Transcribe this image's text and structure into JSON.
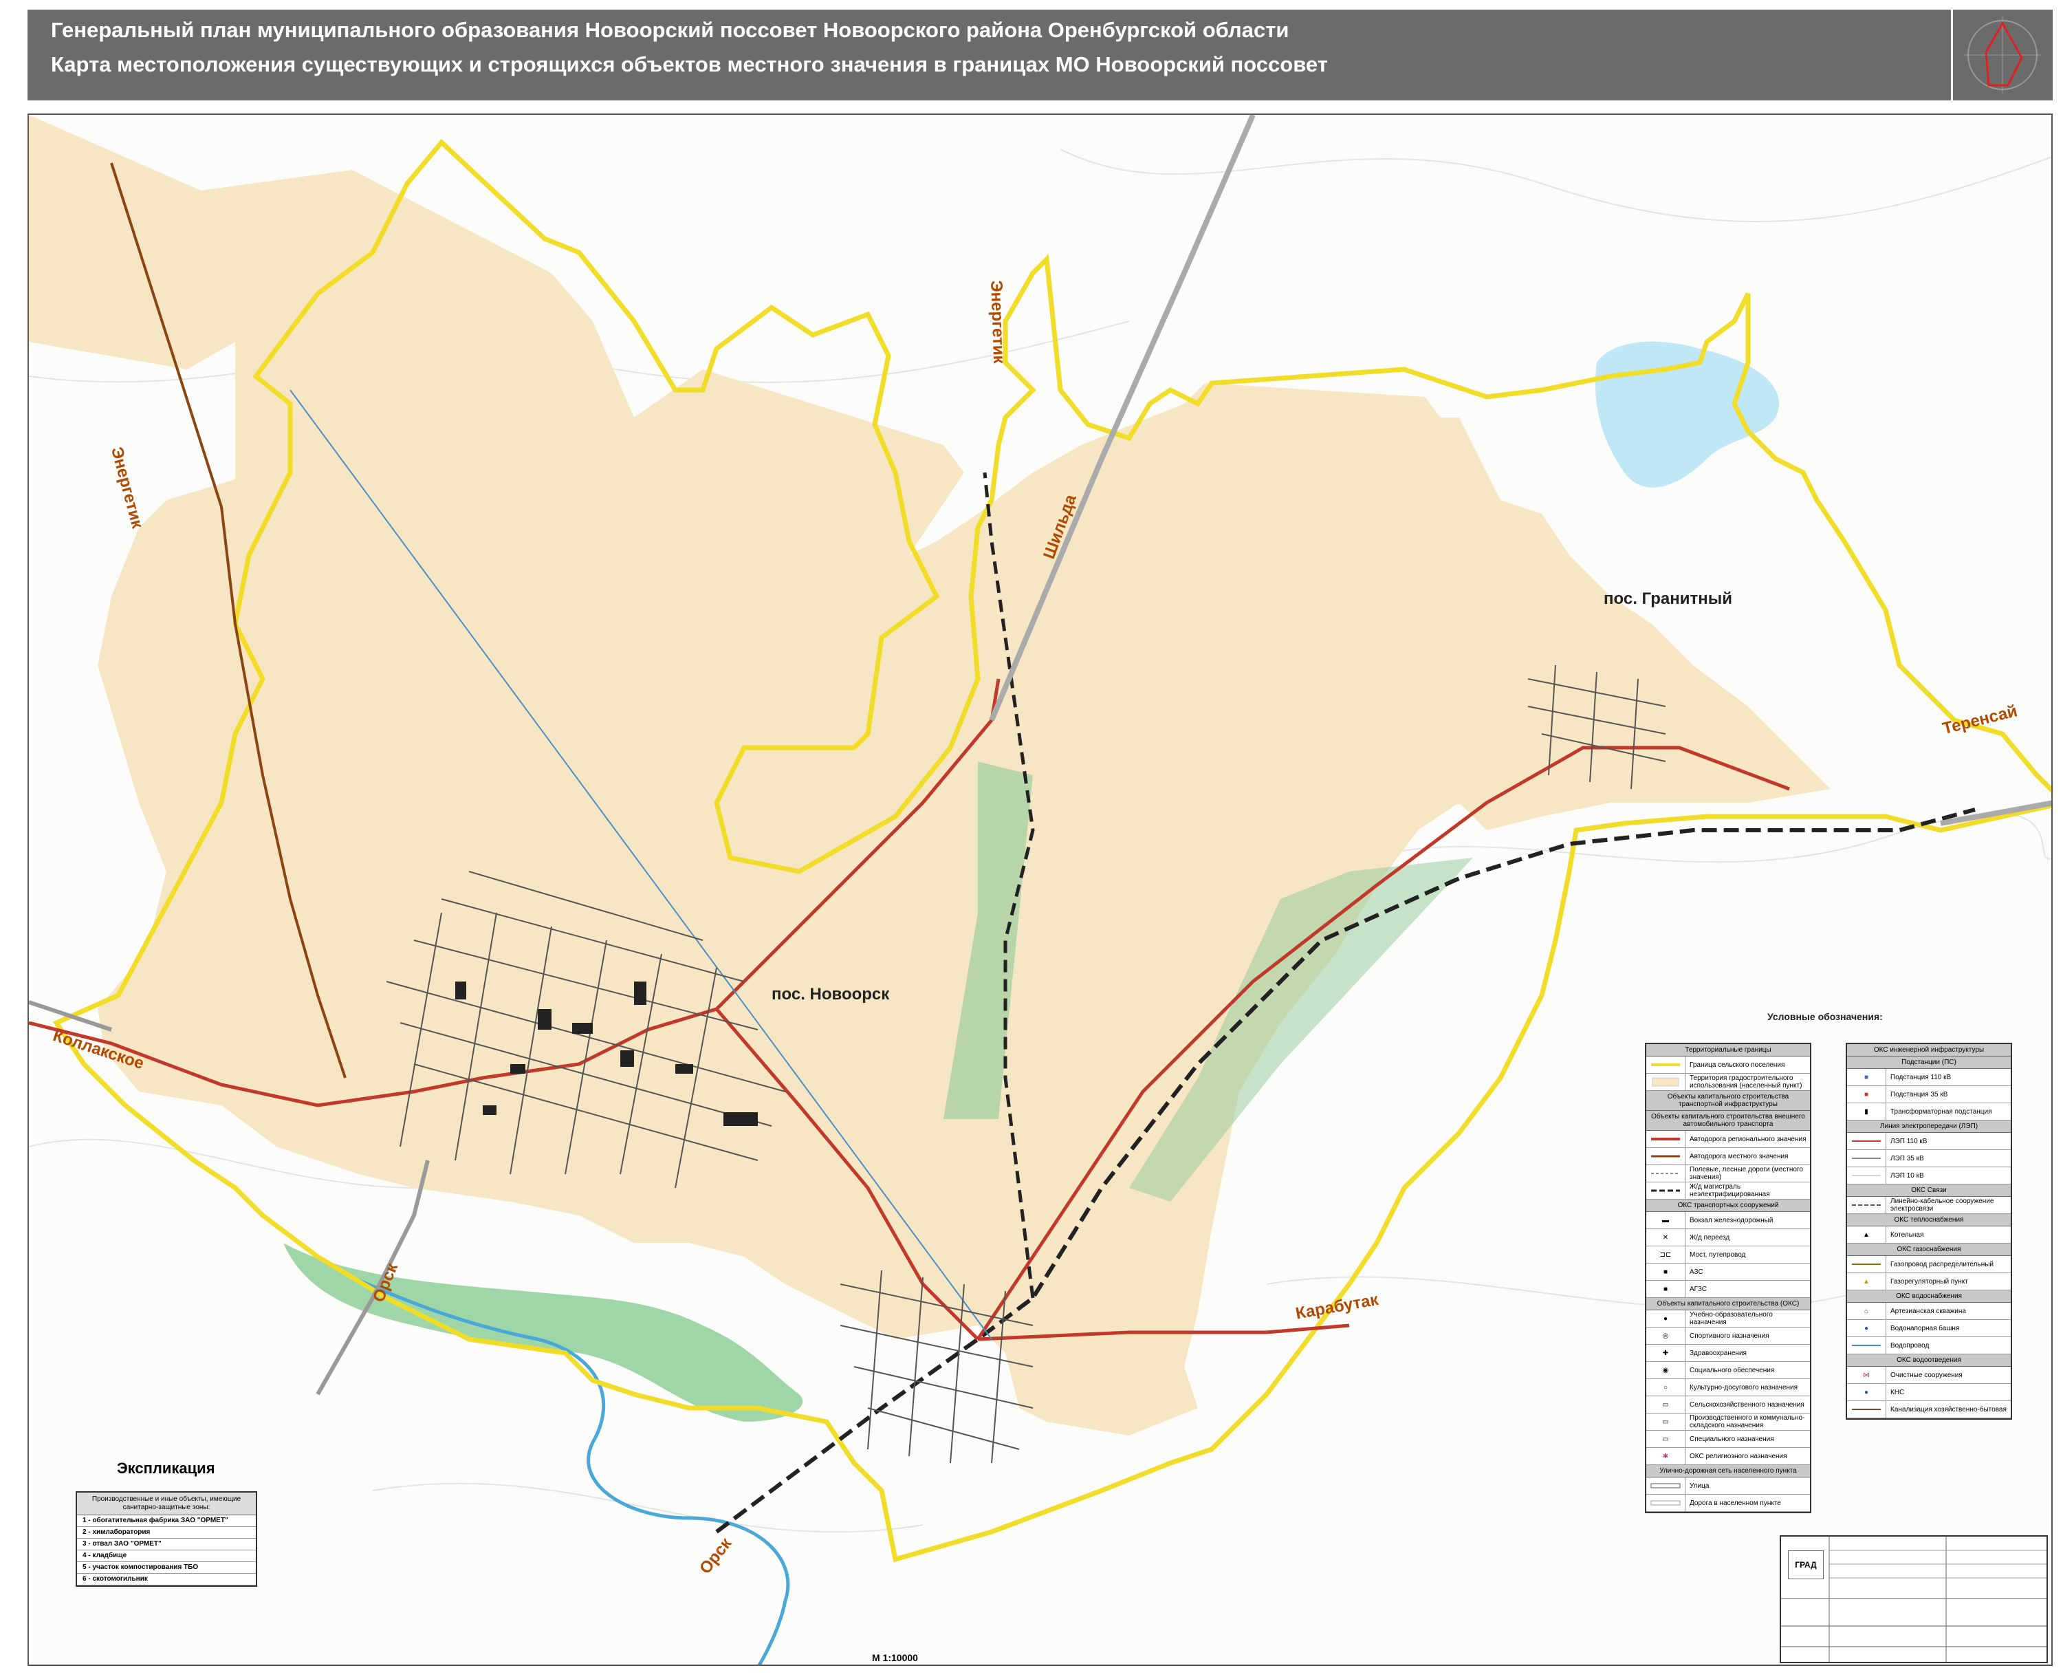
{
  "header": {
    "line1": "Генеральный план муниципального образования Новоорский поссовет Новоорского района Оренбургской области",
    "line2": "Карта местоположения существующих и строящихся объектов местного значения в границах МО Новоорский поссовет"
  },
  "places": {
    "novoorsk": "пос. Новоорск",
    "granitny": "пос. Гранитный"
  },
  "roads": {
    "energetik_left": "Энергетик",
    "energetik_top": "Энергетик",
    "shilda": "Шильда",
    "kollakskoe": "Коллакское",
    "orsk_left": "Орск",
    "orsk_bottom": "Орск",
    "karabutak": "Карабутак",
    "terensay": "Теренсай"
  },
  "legend_title": "Условные обозначения:",
  "legend_left": {
    "sections": [
      {
        "header": "Территориальные границы",
        "rows": [
          "Граница сельского поселения",
          "Территория градостроительного использования (населенный пункт)"
        ]
      },
      {
        "header": "Объекты капитального строительства транспортной инфраструктуры",
        "rows": []
      },
      {
        "header": "Объекты капитального строительства внешнего автомобильного транспорта",
        "rows": [
          "Автодорога регионального значения",
          "Автодорога местного значения",
          "Полевые, лесные дороги (местного значения)",
          "Ж/д магистраль неэлектрифицированная"
        ]
      },
      {
        "header": "ОКС транспортных сооружений",
        "rows": [
          "Вокзал железнодорожный",
          "Ж/д переезд",
          "Мост, путепровод",
          "АЗС",
          "АГЗС"
        ]
      },
      {
        "header": "Объекты капитального строительства (ОКС)",
        "rows": [
          "Учебно-образовательного назначения",
          "Спортивного назначения",
          "Здравоохранения",
          "Социального обеспечения",
          "Культурно-досугового назначения",
          "Сельскохозяйственного назначения",
          "Производственного и коммунально-складского назначения",
          "Специального назначения",
          "ОКС религиозного назначения"
        ]
      },
      {
        "header": "Улично-дорожная сеть населенного пункта",
        "rows": [
          "Улица",
          "Дорога в населенном пункте"
        ]
      }
    ]
  },
  "legend_right": {
    "sections": [
      {
        "header": "ОКС инженерной инфраструктуры",
        "rows": []
      },
      {
        "header": "Подстанции (ПС)",
        "rows": [
          "Подстанция 110 кВ",
          "Подстанция 35 кВ",
          "Трансформаторная подстанция"
        ]
      },
      {
        "header": "Линия электропередачи (ЛЭП)",
        "rows": [
          "ЛЭП 110 кВ",
          "ЛЭП 35 кВ",
          "ЛЭП 10 кВ"
        ]
      },
      {
        "header": "ОКС Связи",
        "rows": [
          "Линейно-кабельное сооружение электросвязи"
        ]
      },
      {
        "header": "ОКС теплоснабжения",
        "rows": [
          "Котельная"
        ]
      },
      {
        "header": "ОКС газоснабжения",
        "rows": [
          "Газопровод распределительный",
          "Газорегуляторный пункт"
        ]
      },
      {
        "header": "ОКС водоснабжения",
        "rows": [
          "Артезианская скважина",
          "Водонапорная башня",
          "Водопровод"
        ]
      },
      {
        "header": "ОКС водоотведения",
        "rows": [
          "Очистные сооружения",
          "КНС",
          "Канализация хозяйственно-бытовая"
        ]
      }
    ]
  },
  "explication": {
    "title": "Экспликация",
    "header": "Производственные и иные объекты, имеющие санитарно-защитные зоны:",
    "items": [
      "1 - обогатительная фабрика ЗАО \"ОРМЕТ\"",
      "2 - химлаборатория",
      "3 - отвал ЗАО \"ОРМЕТ\"",
      "4 - кладбище",
      "5 - участок компостирования ТБО",
      "6 - скотомогильник"
    ]
  },
  "stamp": {
    "logo": "ГРАД"
  },
  "scale": "М  1:10000",
  "colors": {
    "settlement_fill": "#f7e6c4",
    "boundary": "#f2dc2a",
    "regional_road": "#c0392b",
    "local_road": "#8b4513",
    "railway": "#222222",
    "water": "#bfe7f5",
    "green": "#8fc99a"
  }
}
